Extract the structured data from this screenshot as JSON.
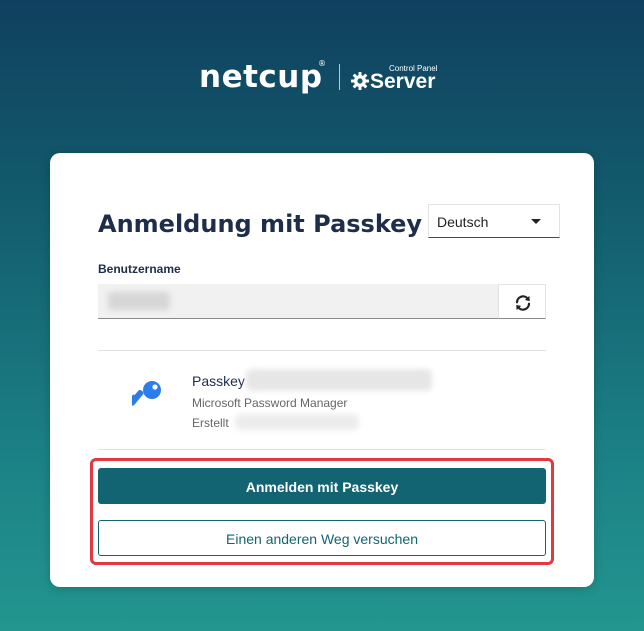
{
  "logo": {
    "brand": "netcup",
    "registered_mark": "®",
    "product_small": "Control Panel",
    "product": "Server"
  },
  "login": {
    "title": "Anmeldung mit Passkey",
    "language": {
      "selected": "Deutsch"
    },
    "username": {
      "label": "Benutzername",
      "value": ""
    },
    "passkey": {
      "name_label": "Passkey",
      "provider": "Microsoft Password Manager",
      "created_label": "Erstellt"
    },
    "buttons": {
      "signin": "Anmelden mit Passkey",
      "alternative": "Einen anderen Weg versuchen"
    }
  },
  "colors": {
    "accent": "#136472",
    "highlight": "#e0393e",
    "title": "#1d2d4a",
    "key_icon": "#2b7de9"
  },
  "icons": {
    "refresh": "refresh-icon",
    "key": "key-icon",
    "gear": "gear-icon",
    "dropdown": "chevron-down-icon"
  }
}
